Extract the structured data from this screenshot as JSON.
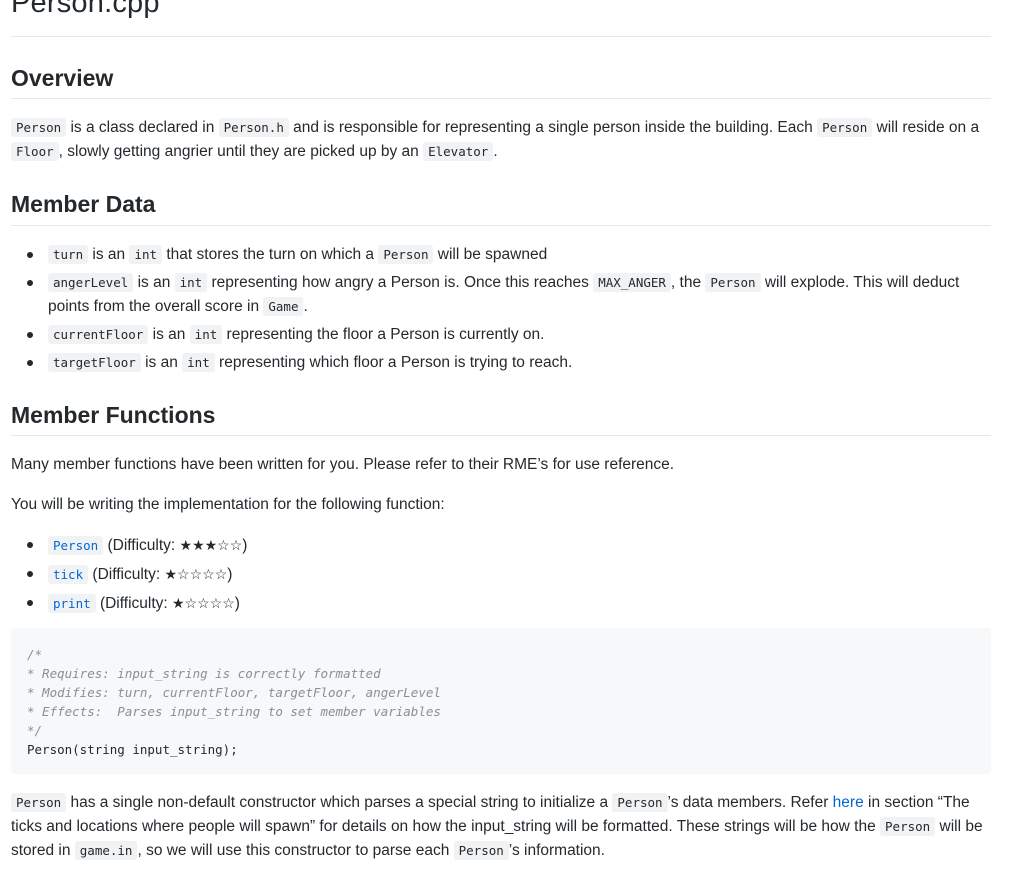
{
  "title": "Person.cpp",
  "overview": {
    "heading": "Overview",
    "p1": {
      "c1": "Person",
      "t1": " is a class declared in ",
      "c2": "Person.h",
      "t2": " and is responsible for representing a single person inside the building. Each ",
      "c3": "Person",
      "t3": " will reside on a ",
      "c4": "Floor",
      "t4": ", slowly getting angrier until they are picked up by an ",
      "c5": "Elevator",
      "t5": "."
    }
  },
  "member_data": {
    "heading": "Member Data",
    "items": [
      {
        "c1": "turn",
        "t1": " is an ",
        "c2": "int",
        "t2": " that stores the turn on which a ",
        "c3": "Person",
        "t3": " will be spawned"
      },
      {
        "c1": "angerLevel",
        "t1": " is an ",
        "c2": "int",
        "t2": " representing how angry a Person is. Once this reaches ",
        "c3": "MAX_ANGER",
        "t3": ", the ",
        "c4": "Person",
        "t4": " will explode. This will deduct points from the overall score in ",
        "c5": "Game",
        "t5": "."
      },
      {
        "c1": "currentFloor",
        "t1": " is an ",
        "c2": "int",
        "t2": " representing the floor a Person is currently on."
      },
      {
        "c1": "targetFloor",
        "t1": " is an ",
        "c2": "int",
        "t2": " representing which floor a Person is trying to reach."
      }
    ]
  },
  "member_functions": {
    "heading": "Member Functions",
    "p1": "Many member functions have been written for you. Please refer to their RME’s for use reference.",
    "p2": "You will be writing the implementation for the following function:",
    "items": [
      {
        "name": "Person",
        "difficulty_label": "(Difficulty: ",
        "stars": "★★★☆☆",
        "close": ")"
      },
      {
        "name": "tick",
        "difficulty_label": "(Difficulty: ",
        "stars": "★☆☆☆☆",
        "close": ")"
      },
      {
        "name": "print",
        "difficulty_label": "(Difficulty: ",
        "stars": "★☆☆☆☆",
        "close": ")"
      }
    ],
    "code": {
      "line1": "/*",
      "line2": "* Requires: input_string is correctly formatted",
      "line3": "* Modifies: turn, currentFloor, targetFloor, angerLevel",
      "line4": "* Effects:  Parses input_string to set member variables",
      "line5": "*/",
      "line6": "Person(string input_string);"
    },
    "p3": {
      "c1": "Person",
      "t1": " has a single non-default constructor which parses a special string to initialize a ",
      "c2": "Person",
      "t2": "’s data members. Refer ",
      "link": "here",
      "t3": " in section “The ticks and locations where people will spawn” for details on how the input_string will be formatted. These strings will be how the ",
      "c3": "Person",
      "t4": " will be stored in ",
      "c4": "game.in",
      "t5": ", so we will use this constructor to parse each ",
      "c5": "Person",
      "t6": "’s information."
    }
  }
}
